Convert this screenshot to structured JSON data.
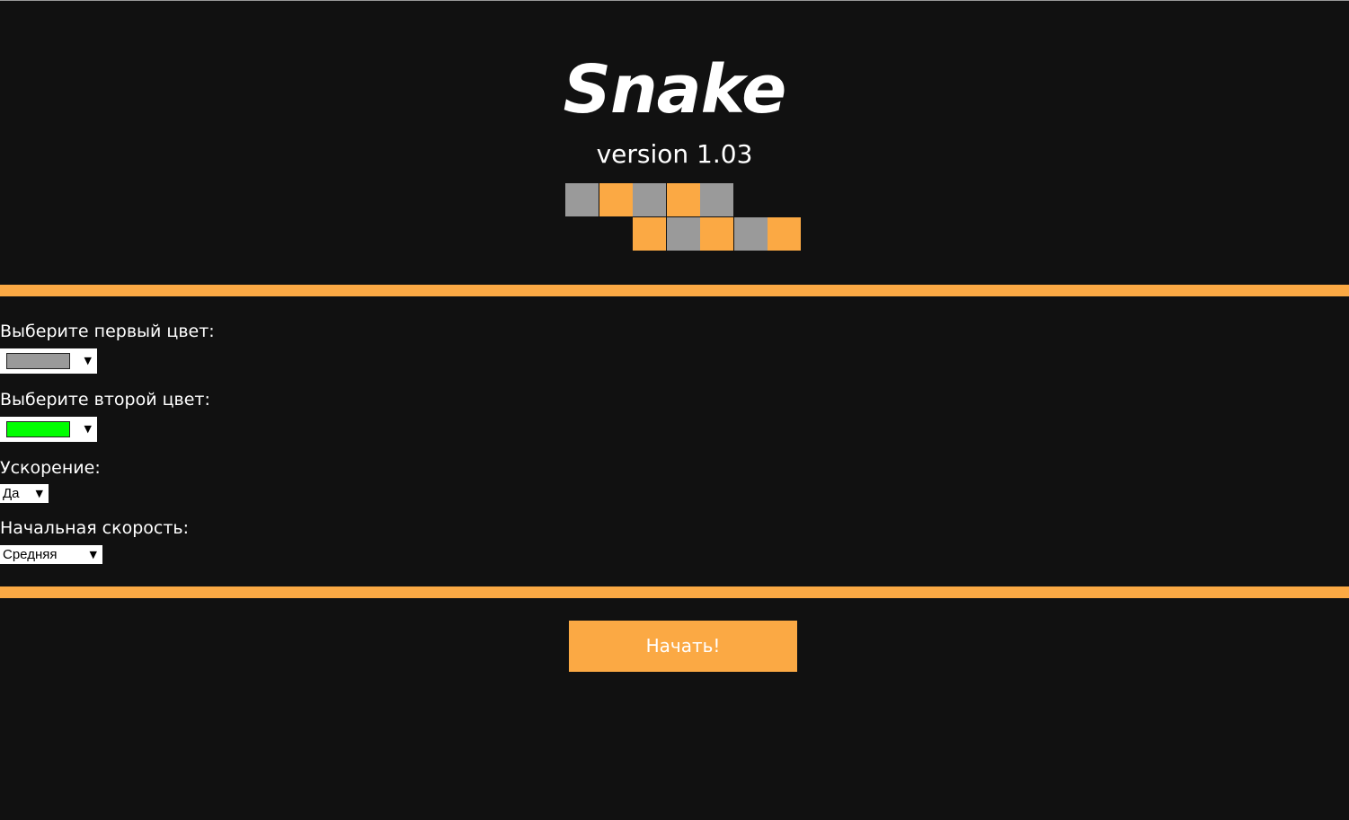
{
  "game": {
    "title": "Snake",
    "version": "version 1.03"
  },
  "colors": {
    "background": "#111111",
    "accent": "#FBA944",
    "gray": "#9A9A9A",
    "white": "#FFFFFF",
    "green": "#00FF00"
  },
  "logo": {
    "pattern_rows": [
      [
        "gray",
        "orange",
        "gray",
        "orange",
        "gray",
        "empty",
        "empty"
      ],
      [
        "empty",
        "empty",
        "orange",
        "gray",
        "orange",
        "gray",
        "orange"
      ]
    ]
  },
  "settings": {
    "first_color": {
      "label": "Выберите первый цвет:",
      "value": "#9A9A9A"
    },
    "second_color": {
      "label": "Выберите второй цвет:",
      "value": "#00FF00"
    },
    "acceleration": {
      "label": "Ускорение:",
      "selected": "Да"
    },
    "initial_speed": {
      "label": "Начальная скорость:",
      "selected": "Средняя"
    }
  },
  "start_button": {
    "label": "Начать!"
  },
  "icons": {
    "dropdown": "dropdown-arrow-icon"
  }
}
